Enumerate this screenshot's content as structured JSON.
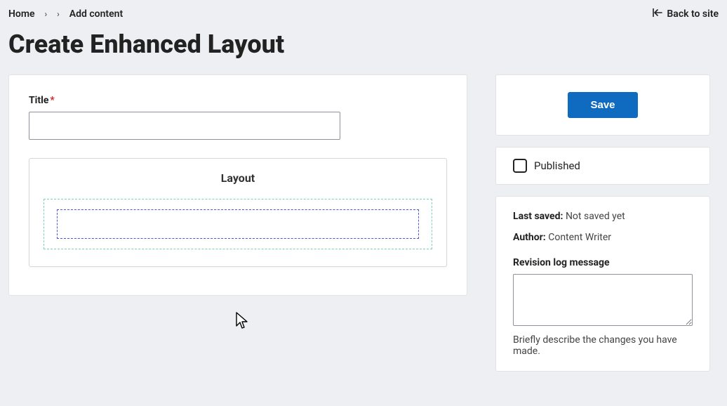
{
  "breadcrumbs": {
    "home": "Home",
    "add_content": "Add content"
  },
  "back_to_site": "Back to site",
  "page_title": "Create Enhanced Layout",
  "main": {
    "title_label": "Title",
    "required_mark": "*",
    "title_value": "",
    "layout_heading": "Layout"
  },
  "actions": {
    "save": "Save"
  },
  "published": {
    "label": "Published",
    "checked": false
  },
  "meta": {
    "last_saved_label": "Last saved:",
    "last_saved_value": "Not saved yet",
    "author_label": "Author:",
    "author_value": "Content Writer",
    "revision_label": "Revision log message",
    "revision_value": "",
    "revision_help": "Briefly describe the changes you have made."
  }
}
